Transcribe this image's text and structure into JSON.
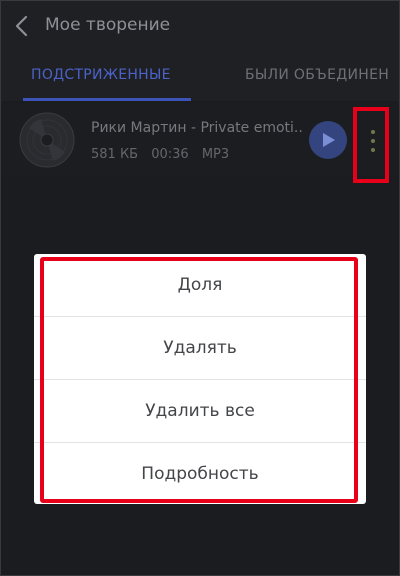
{
  "header": {
    "title": "Мое творение",
    "back_icon": "chevron-left-icon"
  },
  "tabs": [
    {
      "label": "ПОДСТРИЖЕННЫЕ",
      "active": true
    },
    {
      "label": "БЫЛИ ОБЪЕДИНЕН",
      "active": false
    }
  ],
  "track": {
    "title": "Рики Мартин - Private emoti...",
    "size": "581 КБ",
    "duration": "00:36",
    "format": "MP3",
    "thumbnail_icon": "disc-icon",
    "play_icon": "play-icon",
    "more_icon": "more-vertical-icon"
  },
  "menu": {
    "items": [
      "Доля",
      "Удалять",
      "Удалить все",
      "Подробность"
    ]
  },
  "colors": {
    "accent": "#3c54b8",
    "highlight": "#e8001a",
    "background": "#1b1c1f"
  }
}
